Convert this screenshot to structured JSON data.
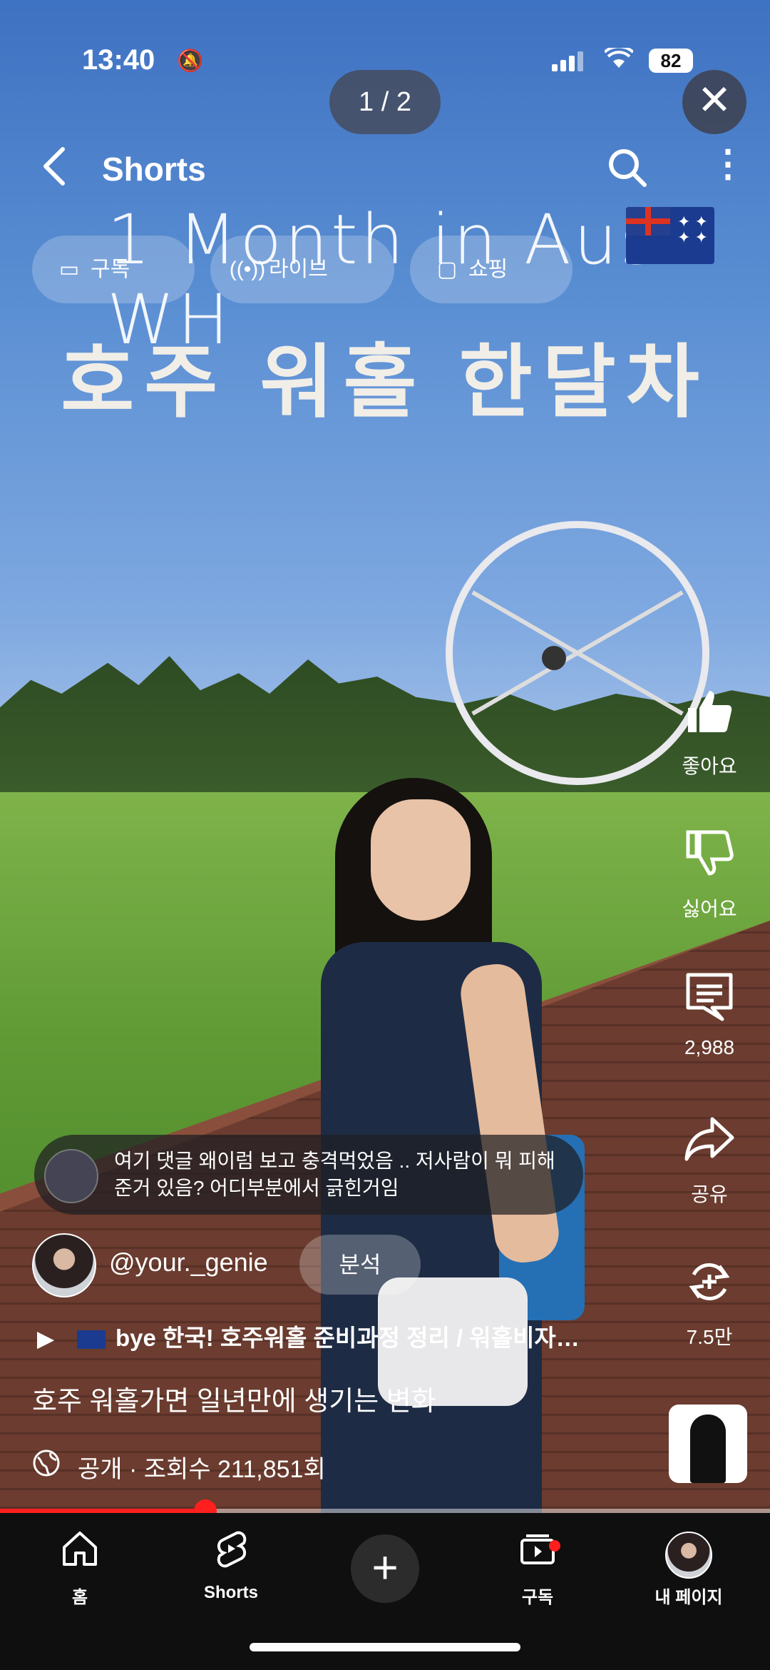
{
  "status_bar": {
    "time": "13:40",
    "battery": "82"
  },
  "viewer": {
    "page_indicator": "1 / 2"
  },
  "header": {
    "title": "Shorts"
  },
  "chips": [
    {
      "label": "구독",
      "icon": "subscriptions-icon"
    },
    {
      "label": "라이브",
      "icon": "live-icon"
    },
    {
      "label": "쇼핑",
      "icon": "shopping-bag-icon"
    }
  ],
  "video_caption": {
    "line1": "1 Month in Aus WH",
    "line2": "호주 워홀 한달차"
  },
  "actions": {
    "like_label": "좋아요",
    "dislike_label": "싫어요",
    "comments_count": "2,988",
    "share_label": "공유",
    "remix_count": "7.5만"
  },
  "pinned_comment": {
    "text": "여기 댓글 왜이럼 보고 충격먹었음 .. 저사람이 뭐 피해준거 있음? 어디부분에서 긁힌거임"
  },
  "channel": {
    "handle": "@your._genie",
    "action_label": "분석"
  },
  "related_video": {
    "title": "bye 한국! 호주워홀 준비과정 정리 / 워홀비자…"
  },
  "description": "호주 워홀가면 일년만에 생기는 변화",
  "meta": "공개 · 조회수 211,851회",
  "progress": {
    "fraction": 0.267
  },
  "bottom_nav": {
    "home": "홈",
    "shorts": "Shorts",
    "subscriptions": "구독",
    "my_page": "내 페이지"
  },
  "colors": {
    "accent_red": "#ff1f1f",
    "nav_bg": "#0f0f0f"
  }
}
